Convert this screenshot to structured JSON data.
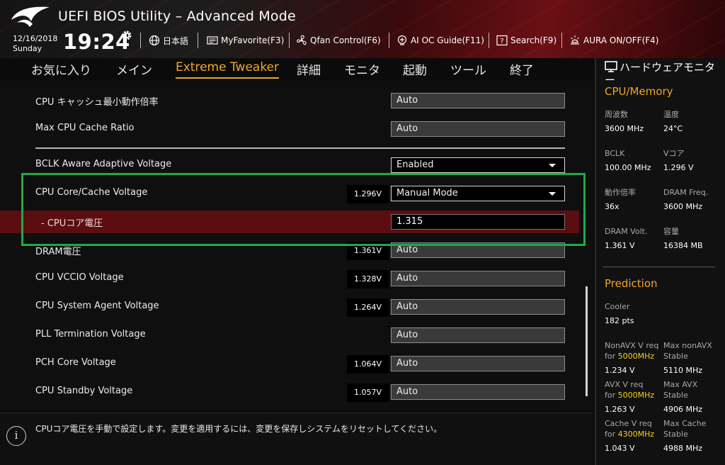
{
  "header": {
    "title": "UEFI BIOS Utility – Advanced Mode",
    "date": "12/16/2018",
    "day": "Sunday",
    "time": "19:24",
    "buttons": [
      {
        "label": "日本語",
        "icon": "globe-icon"
      },
      {
        "label": "MyFavorite(F3)",
        "icon": "favorite-icon"
      },
      {
        "label": "Qfan Control(F6)",
        "icon": "fan-icon"
      },
      {
        "label": "AI OC Guide(F11)",
        "icon": "ai-oc-guide-icon"
      },
      {
        "label": "Search(F9)",
        "icon": "search-help-icon"
      },
      {
        "label": "AURA ON/OFF(F4)",
        "icon": "aura-light-icon"
      }
    ]
  },
  "tabs": [
    "お気に入り",
    "メイン",
    "Extreme Tweaker",
    "詳細",
    "モニタ",
    "起動",
    "ツール",
    "終了"
  ],
  "active_tab": "Extreme Tweaker",
  "settings": [
    {
      "label": "CPU キャッシュ最小動作倍率",
      "voltage": "",
      "value": "Auto",
      "type": "text"
    },
    {
      "label": "Max CPU Cache Ratio",
      "voltage": "",
      "value": "Auto",
      "type": "text"
    },
    {
      "label": "BCLK Aware Adaptive Voltage",
      "voltage": "",
      "value": "Enabled",
      "type": "dropdown"
    },
    {
      "label": "CPU Core/Cache Voltage",
      "voltage": "1.296V",
      "value": "Manual Mode",
      "type": "dropdown"
    },
    {
      "label": "- CPUコア電圧",
      "voltage": "",
      "value": "1.315",
      "type": "input"
    },
    {
      "label": "DRAM電圧",
      "voltage": "1.361V",
      "value": "Auto",
      "type": "text"
    },
    {
      "label": "CPU VCCIO Voltage",
      "voltage": "1.328V",
      "value": "Auto",
      "type": "text"
    },
    {
      "label": "CPU System Agent Voltage",
      "voltage": "1.264V",
      "value": "Auto",
      "type": "text"
    },
    {
      "label": "PLL Termination Voltage",
      "voltage": "",
      "value": "Auto",
      "type": "text"
    },
    {
      "label": "PCH Core Voltage",
      "voltage": "1.064V",
      "value": "Auto",
      "type": "text"
    },
    {
      "label": "CPU Standby Voltage",
      "voltage": "1.057V",
      "value": "Auto",
      "type": "text"
    }
  ],
  "help_text": "CPUコア電圧を手動で設定します。変更を適用するには、変更を保存しシステムをリセットしてください。",
  "hardware_monitor": {
    "title": "ハードウェアモニター",
    "cpu_memory": {
      "heading": "CPU/Memory",
      "items": [
        {
          "label": "周波数",
          "value": "3600 MHz"
        },
        {
          "label": "温度",
          "value": "24°C"
        },
        {
          "label": "BCLK",
          "value": "100.00 MHz"
        },
        {
          "label": "Vコア",
          "value": "1.296 V"
        },
        {
          "label": "動作倍率",
          "value": "36x"
        },
        {
          "label": "DRAM Freq.",
          "value": "3600 MHz"
        },
        {
          "label": "DRAM Volt.",
          "value": "1.361 V"
        },
        {
          "label": "容量",
          "value": "16384 MB"
        }
      ]
    },
    "prediction": {
      "heading": "Prediction",
      "cooler_label": "Cooler",
      "cooler_value": "182 pts",
      "items": [
        {
          "label": "NonAVX V req",
          "for": "for",
          "freq": "5000MHz",
          "value": "1.234 V"
        },
        {
          "label": "Max nonAVX",
          "sub": "Stable",
          "value": "5110 MHz"
        },
        {
          "label": "AVX V req",
          "for": "for",
          "freq": "5000MHz",
          "value": "1.263 V"
        },
        {
          "label": "Max AVX",
          "sub": "Stable",
          "value": "4906 MHz"
        },
        {
          "label": "Cache V req",
          "for": "for",
          "freq": "4300MHz",
          "value": "1.043 V"
        },
        {
          "label": "Max Cache",
          "sub": "Stable",
          "value": "4988 MHz"
        }
      ]
    }
  },
  "colors": {
    "accent": "#f2a623",
    "selection": "#5b0d10",
    "highlight_box": "#22a74a",
    "freq_highlight": "#f2d21d"
  }
}
